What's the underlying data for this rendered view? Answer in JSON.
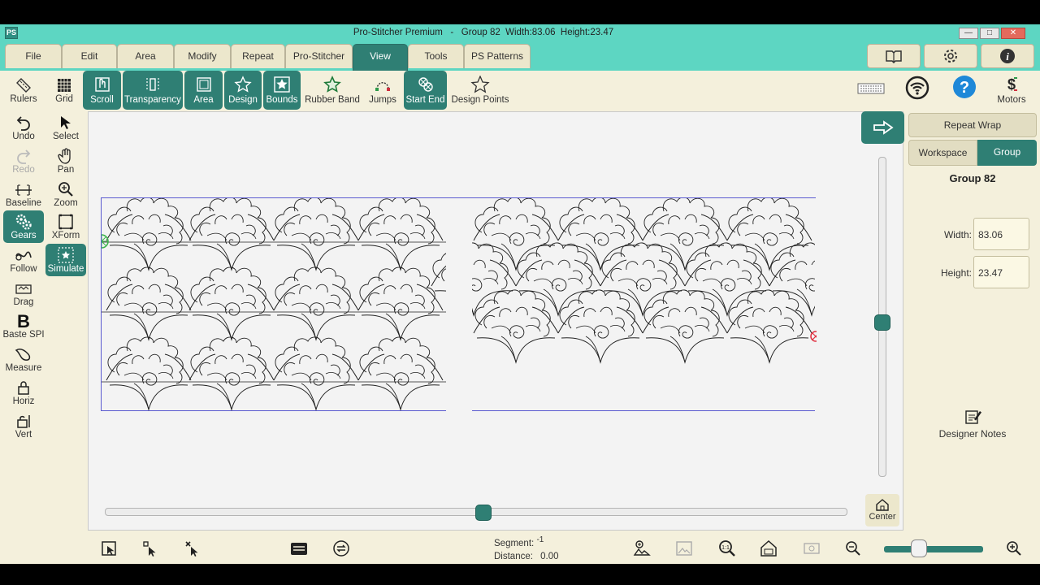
{
  "window": {
    "title_app": "Pro-Stitcher Premium",
    "title_group": "Group 82",
    "title_width": "Width:83.06",
    "title_height": "Height:23.47",
    "logo": "PS"
  },
  "menu": {
    "tabs": [
      "File",
      "Edit",
      "Area",
      "Modify",
      "Repeat",
      "Pro-Stitcher",
      "View",
      "Tools",
      "PS Patterns"
    ],
    "active": "View",
    "right_buttons": [
      "book-icon",
      "gear-icon",
      "info-icon"
    ]
  },
  "toolbar": {
    "items": [
      {
        "label": "Rulers",
        "icon": "ruler-icon",
        "on": false
      },
      {
        "label": "Grid",
        "icon": "grid-icon",
        "on": false
      },
      {
        "label": "Scroll",
        "icon": "scroll-icon",
        "on": true
      },
      {
        "label": "Transparency",
        "icon": "transparency-icon",
        "on": true
      },
      {
        "label": "Area",
        "icon": "area-icon",
        "on": true
      },
      {
        "label": "Design",
        "icon": "star-outline-icon",
        "on": true
      },
      {
        "label": "Bounds",
        "icon": "star-box-icon",
        "on": true
      },
      {
        "label": "Rubber Band",
        "icon": "rubber-band-icon",
        "on": false
      },
      {
        "label": "Jumps",
        "icon": "jumps-icon",
        "on": false
      },
      {
        "label": "Start End",
        "icon": "start-end-icon",
        "on": true
      },
      {
        "label": "Design Points",
        "icon": "design-points-icon",
        "on": false
      }
    ],
    "motors_label": "Motors"
  },
  "sidebar_left": [
    {
      "label": "Undo",
      "icon": "undo-icon",
      "state": "normal"
    },
    {
      "label": "Redo",
      "icon": "redo-icon",
      "state": "disabled"
    },
    {
      "label": "Baseline",
      "icon": "baseline-icon",
      "state": "normal"
    },
    {
      "label": "Gears",
      "icon": "gears-icon",
      "state": "on"
    },
    {
      "label": "Follow",
      "icon": "follow-icon",
      "state": "normal"
    },
    {
      "label": "Drag",
      "icon": "drag-icon",
      "state": "normal"
    },
    {
      "label": "Baste SPI",
      "icon": "baste-icon",
      "state": "normal"
    },
    {
      "label": "Measure",
      "icon": "measure-icon",
      "state": "normal"
    },
    {
      "label": "Horiz",
      "icon": "horiz-lock-icon",
      "state": "normal"
    },
    {
      "label": "Vert",
      "icon": "vert-lock-icon",
      "state": "normal"
    }
  ],
  "sidebar_right_col": [
    {
      "label": "Select",
      "icon": "select-icon",
      "state": "normal"
    },
    {
      "label": "Pan",
      "icon": "hand-icon",
      "state": "normal"
    },
    {
      "label": "Zoom",
      "icon": "zoom-icon",
      "state": "normal"
    },
    {
      "label": "XForm",
      "icon": "xform-icon",
      "state": "normal"
    },
    {
      "label": "Simulate",
      "icon": "simulate-icon",
      "state": "on"
    }
  ],
  "canvas": {
    "center_label": "Center",
    "horizontal_scroll_fraction": 0.51,
    "vertical_scroll_fraction": 0.52
  },
  "panel": {
    "repeat_wrap": "Repeat Wrap",
    "tab_workspace": "Workspace",
    "tab_group": "Group",
    "group_title": "Group 82",
    "width_label": "Width:",
    "width_value": "83.06",
    "height_label": "Height:",
    "height_value": "23.47",
    "designer_notes": "Designer Notes"
  },
  "bottom": {
    "segment_label": "Segment:",
    "segment_value": "-1",
    "distance_label": "Distance:",
    "distance_value": "0.00",
    "zoom_fraction": 0.32
  },
  "colors": {
    "accent": "#2f7f74",
    "titlebar": "#5dd6c2",
    "background": "#f4f0dc",
    "bounds": "#5a5ad0",
    "start_marker": "#3cb44b",
    "end_marker": "#e03040"
  }
}
